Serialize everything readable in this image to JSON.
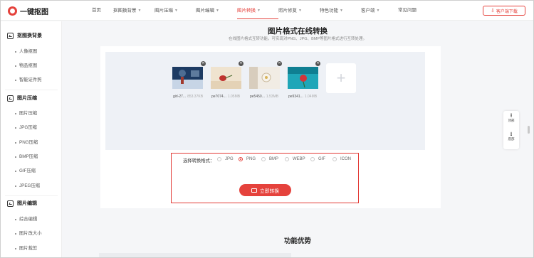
{
  "header": {
    "logo_text": "一键抠图",
    "nav": [
      {
        "label": "首页",
        "caret": false
      },
      {
        "label": "抠图换背景",
        "caret": true
      },
      {
        "label": "图片压缩",
        "caret": true
      },
      {
        "label": "图片编辑",
        "caret": true
      },
      {
        "label": "图片转换",
        "caret": true,
        "active": true
      },
      {
        "label": "照片修复",
        "caret": true
      },
      {
        "label": "特色功能",
        "caret": true
      },
      {
        "label": "客户端",
        "caret": true
      },
      {
        "label": "常见问题",
        "caret": false
      }
    ],
    "download_label": "客户端下载"
  },
  "sidebar": {
    "sections": [
      {
        "title": "抠图换背景",
        "items": [
          "人像抠图",
          "物品抠图",
          "智能证件照"
        ]
      },
      {
        "title": "图片压缩",
        "items": [
          "图片压缩",
          "JPG压缩",
          "PNG压缩",
          "BMP压缩",
          "GIF压缩",
          "JPEG压缩"
        ]
      },
      {
        "title": "图片编辑",
        "items": [
          "综合编辑",
          "图片改大小",
          "图片裁剪"
        ]
      }
    ]
  },
  "main": {
    "title": "图片格式在线转换",
    "subtitle": "在线图片格式互转功能，可实现对PNG、JPG、BMP等图片格式进行互转处理。",
    "files": [
      {
        "name": "girl-27...",
        "size": "853.37KB"
      },
      {
        "name": "pe7074...",
        "size": "1.05MB"
      },
      {
        "name": "pe5450...",
        "size": "1.53MB"
      },
      {
        "name": "pe9341...",
        "size": "1.04MB"
      }
    ],
    "add_icon": "+",
    "format_label": "选择转换格式：",
    "formats": [
      "JPG",
      "PNG",
      "BMP",
      "WEBP",
      "GIF",
      "ICON"
    ],
    "selected_format": "PNG",
    "convert_label": "立即转换",
    "section2_title": "功能优势"
  },
  "float": {
    "top_label": "顶部",
    "bottom_label": "底部"
  },
  "colors": {
    "accent": "#e5423c",
    "highlight_box": "#e33b36"
  }
}
